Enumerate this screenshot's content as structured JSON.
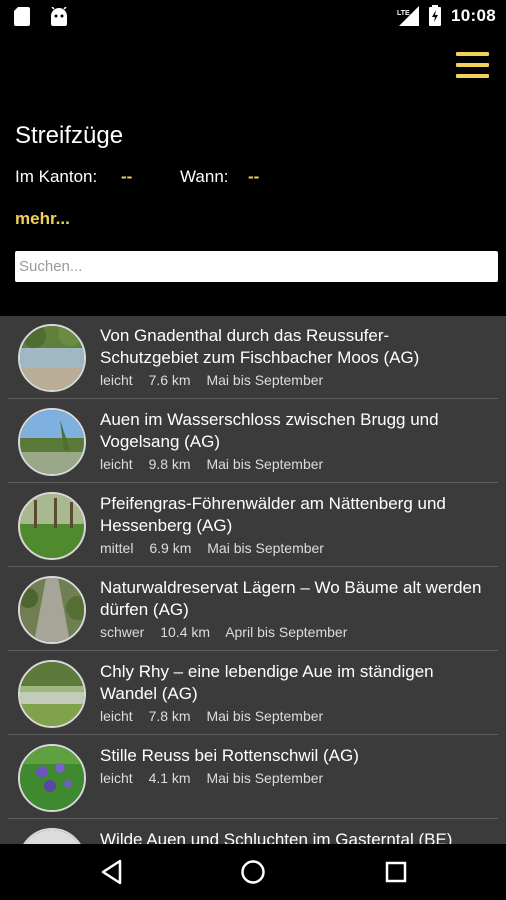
{
  "status_bar": {
    "time": "10:08",
    "left_icons": [
      "sd-card-icon",
      "android-icon"
    ],
    "right_icons": [
      "lte-signal-icon",
      "battery-charging-icon"
    ]
  },
  "header": {
    "title": "Streifzüge",
    "canton_label": "Im Kanton:",
    "canton_value": "--",
    "when_label": "Wann:",
    "when_value": "--",
    "more_link": "mehr...",
    "menu_icon": "hamburger-menu-icon"
  },
  "search": {
    "placeholder": "Suchen...",
    "value": ""
  },
  "list": {
    "items": [
      {
        "title": "Von Gnadenthal durch das Reussufer-Schutzgebiet zum Fischbacher Moos (AG)",
        "difficulty": "leicht",
        "distance": "7.6 km",
        "season": "Mai bis September",
        "thumb": "river-bank"
      },
      {
        "title": "Auen im Wasserschloss zwischen Brugg und Vogelsang (AG)",
        "difficulty": "leicht",
        "distance": "9.8 km",
        "season": "Mai bis September",
        "thumb": "river-sky"
      },
      {
        "title": "Pfeifengras-Föhrenwälder am Nättenberg und Hessenberg (AG)",
        "difficulty": "mittel",
        "distance": "6.9 km",
        "season": "Mai bis September",
        "thumb": "pine-meadow"
      },
      {
        "title": "Naturwaldreservat Lägern – Wo Bäume alt werden dürfen (AG)",
        "difficulty": "schwer",
        "distance": "10.4 km",
        "season": "April bis September",
        "thumb": "forest-path"
      },
      {
        "title": "Chly Rhy – eine lebendige Aue im ständigen Wandel (AG)",
        "difficulty": "leicht",
        "distance": "7.8 km",
        "season": "Mai bis September",
        "thumb": "wetland"
      },
      {
        "title": "Stille Reuss bei Rottenschwil (AG)",
        "difficulty": "leicht",
        "distance": "4.1 km",
        "season": "Mai bis September",
        "thumb": "iris-flowers"
      },
      {
        "title": "Wilde Auen und Schluchten im Gasterntal (BE)",
        "difficulty": "",
        "distance": "",
        "season": "",
        "thumb": "mountain-gorge"
      }
    ]
  },
  "nav_bar": {
    "icons": [
      "back-icon",
      "home-icon",
      "recents-icon"
    ]
  },
  "colors": {
    "accent": "#f2d15a",
    "list_bg": "#3b3b3b",
    "background": "#000000"
  }
}
